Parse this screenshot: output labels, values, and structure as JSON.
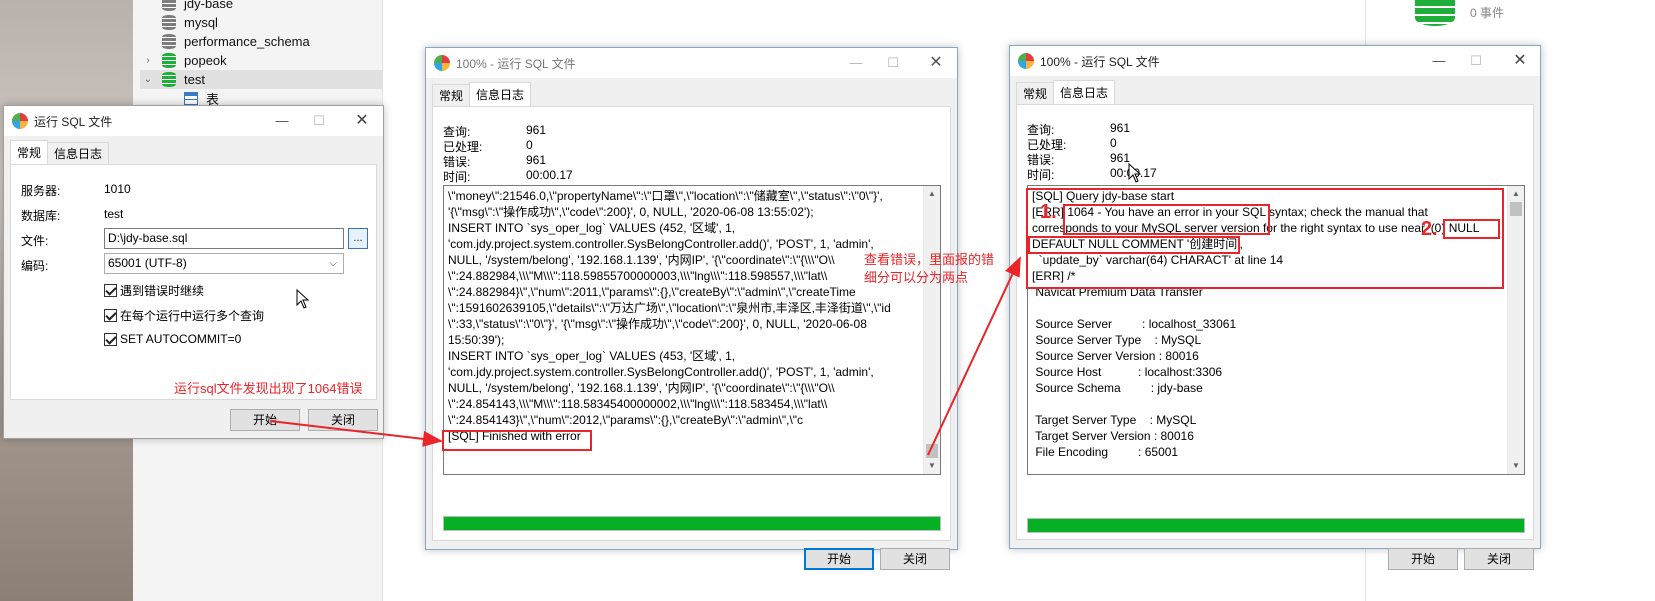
{
  "navicat": {
    "tree": [
      {
        "label": "jdy-base",
        "icon": "grey",
        "arrow": ""
      },
      {
        "label": "mysql",
        "icon": "grey",
        "arrow": ""
      },
      {
        "label": "performance_schema",
        "icon": "grey",
        "arrow": ""
      },
      {
        "label": "popeok",
        "icon": "green",
        "arrow": "›"
      },
      {
        "label": "test",
        "icon": "green",
        "arrow": "⌄"
      },
      {
        "label": "表",
        "icon": "table",
        "arrow": ""
      }
    ],
    "events_label": "0 事件"
  },
  "win1": {
    "title": "运行 SQL 文件",
    "tabs": [
      "常规",
      "信息日志"
    ],
    "fields": {
      "server_label": "服务器:",
      "server_value": "1010",
      "db_label": "数据库:",
      "db_value": "test",
      "file_label": "文件:",
      "file_value": "D:\\jdy-base.sql",
      "browse_label": "...",
      "encoding_label": "编码:",
      "encoding_value": "65001 (UTF-8)"
    },
    "checks": [
      "遇到错误时继续",
      "在每个运行中运行多个查询",
      "SET AUTOCOMMIT=0"
    ],
    "start_label": "开始",
    "close_label": "关闭"
  },
  "win2": {
    "title": "100% - 运行 SQL 文件",
    "tabs": [
      "常规",
      "信息日志"
    ],
    "stats": [
      {
        "label": "查询:",
        "value": "961"
      },
      {
        "label": "已处理:",
        "value": "0"
      },
      {
        "label": "错误:",
        "value": "961"
      },
      {
        "label": "时间:",
        "value": "00:00.17"
      }
    ],
    "log": [
      "\\\"money\\\":21546.0,\\\"propertyName\\\":\\\"口罩\\\",\\\"location\\\":\\\"储藏室\\\",\\\"status\\\":\\\"0\\\"}',",
      "'{\\\"msg\\\":\\\"操作成功\\\",\\\"code\\\":200}', 0, NULL, '2020-06-08 13:55:02');",
      "INSERT INTO `sys_oper_log` VALUES (452, '区域', 1,",
      "'com.jdy.project.system.controller.SysBelongController.add()', 'POST', 1, 'admin',",
      "NULL, '/system/belong', '192.168.1.139', '内网IP', '{\\\"coordinate\\\":\\\"{\\\\\\\"O\\\\",
      "\\\":24.882984,\\\\\\\"M\\\\\\\":118.59855700000003,\\\\\\\"lng\\\\\\\":118.598557,\\\\\\\"lat\\\\",
      "\\\":24.882984}\\\",\\\"num\\\":2011,\\\"params\\\":{},\\\"createBy\\\":\\\"admin\\\",\\\"createTime",
      "\\\":1591602639105,\\\"details\\\":\\\"万达广场\\\",\\\"location\\\":\\\"泉州市,丰泽区,丰泽街道\\\",\\\"id",
      "\\\":33,\\\"status\\\":\\\"0\\\"}', '{\\\"msg\\\":\\\"操作成功\\\",\\\"code\\\":200}', 0, NULL, '2020-06-08",
      "15:50:39');",
      "INSERT INTO `sys_oper_log` VALUES (453, '区域', 1,",
      "'com.jdy.project.system.controller.SysBelongController.add()', 'POST', 1, 'admin',",
      "NULL, '/system/belong', '192.168.1.139', '内网IP', '{\\\"coordinate\\\":\\\"{\\\\\\\"O\\\\",
      "\\\":24.854143,\\\\\\\"M\\\\\\\":118.58345400000002,\\\\\\\"lng\\\\\\\":118.583454,\\\\\\\"lat\\\\",
      "\\\":24.854143}\\\",\\\"num\\\":2012,\\\"params\\\":{},\\\"createBy\\\":\\\"admin\\\",\\\"c",
      "[SQL] Finished with error"
    ],
    "progress": 1.0,
    "start_label": "开始",
    "close_label": "关闭"
  },
  "win3": {
    "title": "100% - 运行 SQL 文件",
    "tabs": [
      "常规",
      "信息日志"
    ],
    "stats": [
      {
        "label": "查询:",
        "value": "961"
      },
      {
        "label": "已处理:",
        "value": "0"
      },
      {
        "label": "错误:",
        "value": "961"
      },
      {
        "label": "时间:",
        "value": "00:00.17"
      }
    ],
    "log": [
      "[SQL] Query jdy-base start",
      "[ERR] 1064 - You have an error in your SQL syntax; check the manual that",
      "corresponds to your MySQL server version for the right syntax to use near '(0) NULL",
      "DEFAULT NULL COMMENT '创建时间',",
      "  `update_by` varchar(64) CHARACT' at line 14",
      "[ERR] /*",
      " Navicat Premium Data Transfer",
      "",
      " Source Server         : localhost_33061",
      " Source Server Type    : MySQL",
      " Source Server Version : 80016",
      " Source Host           : localhost:3306",
      " Source Schema         : jdy-base",
      "",
      " Target Server Type    : MySQL",
      " Target Server Version : 80016",
      " File Encoding         : 65001"
    ],
    "progress": 1.0,
    "start_label": "开始",
    "close_label": "关闭"
  },
  "annotations": {
    "run_note": "运行sql文件发现出现了1064错误",
    "check_note_1": "查看错误，里面报的错",
    "check_note_2": "细分可以分为两点",
    "mark_1": "1.",
    "mark_2": "2."
  },
  "colors": {
    "annotation": "#e8252a",
    "progress": "#06b025",
    "accent": "#0078d7"
  }
}
